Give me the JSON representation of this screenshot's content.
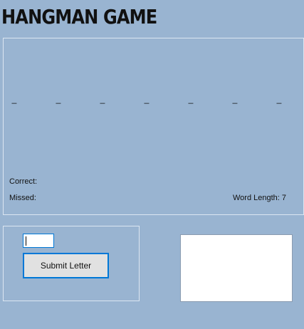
{
  "title": "HANGMAN GAME",
  "word_blanks": [
    "_",
    "_",
    "_",
    "_",
    "_",
    "_",
    "_"
  ],
  "labels": {
    "correct": "Correct:",
    "missed": "Missed:",
    "word_length": "Word Length: 7"
  },
  "input": {
    "letter_value": ""
  },
  "buttons": {
    "submit_label": "Submit Letter"
  },
  "colors": {
    "form_background": "#99b4d1",
    "groupbox_border": "#dce6f1",
    "focus_accent": "#0078d7",
    "button_face": "#e1e1e1",
    "picture_background": "#ffffff"
  }
}
